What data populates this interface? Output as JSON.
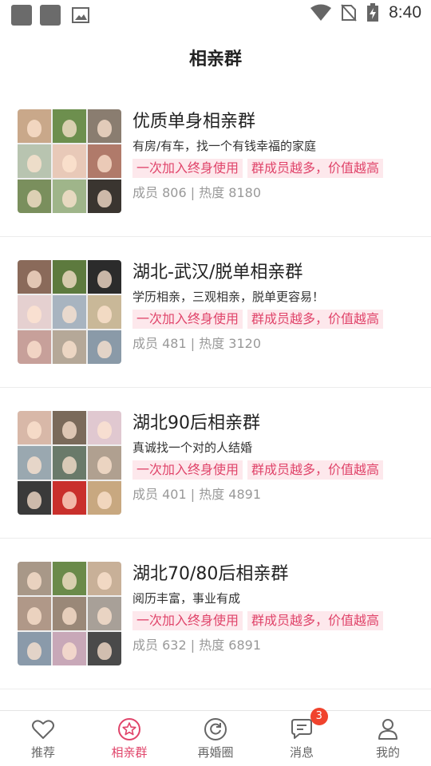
{
  "status_bar": {
    "time": "8:40"
  },
  "header": {
    "title": "相亲群"
  },
  "groups": [
    {
      "name": "优质单身相亲群",
      "description": "有房/有车，找一个有钱幸福的家庭",
      "tags": [
        "一次加入终身使用",
        "群成员越多，价值越高"
      ],
      "stats": "成员 806 | 热度 8180",
      "avatar_colors": [
        "#c9a88a",
        "#6d8f4e",
        "#8a7d70",
        "#b8c4b0",
        "#e8c9b8",
        "#b07a6a",
        "#7a8f5d",
        "#9fb58a",
        "#3a3530"
      ]
    },
    {
      "name": "湖北-武汉/脱单相亲群",
      "description": "学历相亲，三观相亲，脱单更容易！",
      "tags": [
        "一次加入终身使用",
        "群成员越多，价值越高"
      ],
      "stats": "成员 481 | 热度 3120",
      "avatar_colors": [
        "#8a6a5a",
        "#5d7a3e",
        "#2b2b2b",
        "#e5d0d0",
        "#a8b4c0",
        "#c9b898",
        "#c7a09a",
        "#b5a898",
        "#8a9aa8"
      ]
    },
    {
      "name": "湖北90后相亲群",
      "description": "真诚找一个对的人结婚",
      "tags": [
        "一次加入终身使用",
        "群成员越多，价值越高"
      ],
      "stats": "成员 401 | 热度 4891",
      "avatar_colors": [
        "#d8b8a8",
        "#7a6a5a",
        "#e0c8d0",
        "#9aa8b0",
        "#6a7a6a",
        "#b0a090",
        "#3a3a3a",
        "#c9302c",
        "#c8a880"
      ]
    },
    {
      "name": "湖北70/80后相亲群",
      "description": "阅历丰富，事业有成",
      "tags": [
        "一次加入终身使用",
        "群成员越多，价值越高"
      ],
      "stats": "成员 632 | 热度 6891",
      "avatar_colors": [
        "#a89888",
        "#6a8a4a",
        "#c8b098",
        "#b09888",
        "#9a8878",
        "#a8a098",
        "#8a9aaa",
        "#c8a8b8",
        "#4a4a4a"
      ]
    }
  ],
  "nav": [
    {
      "label": "推荐",
      "icon": "heart-icon",
      "active": false
    },
    {
      "label": "相亲群",
      "icon": "star-circle-icon",
      "active": true
    },
    {
      "label": "再婚圈",
      "icon": "refresh-circle-icon",
      "active": false
    },
    {
      "label": "消息",
      "icon": "chat-bubble-icon",
      "active": false,
      "badge": "3"
    },
    {
      "label": "我的",
      "icon": "person-icon",
      "active": false
    }
  ],
  "colors": {
    "accent": "#e0446a",
    "tag_bg": "#fde8ec",
    "badge": "#f0432d"
  }
}
